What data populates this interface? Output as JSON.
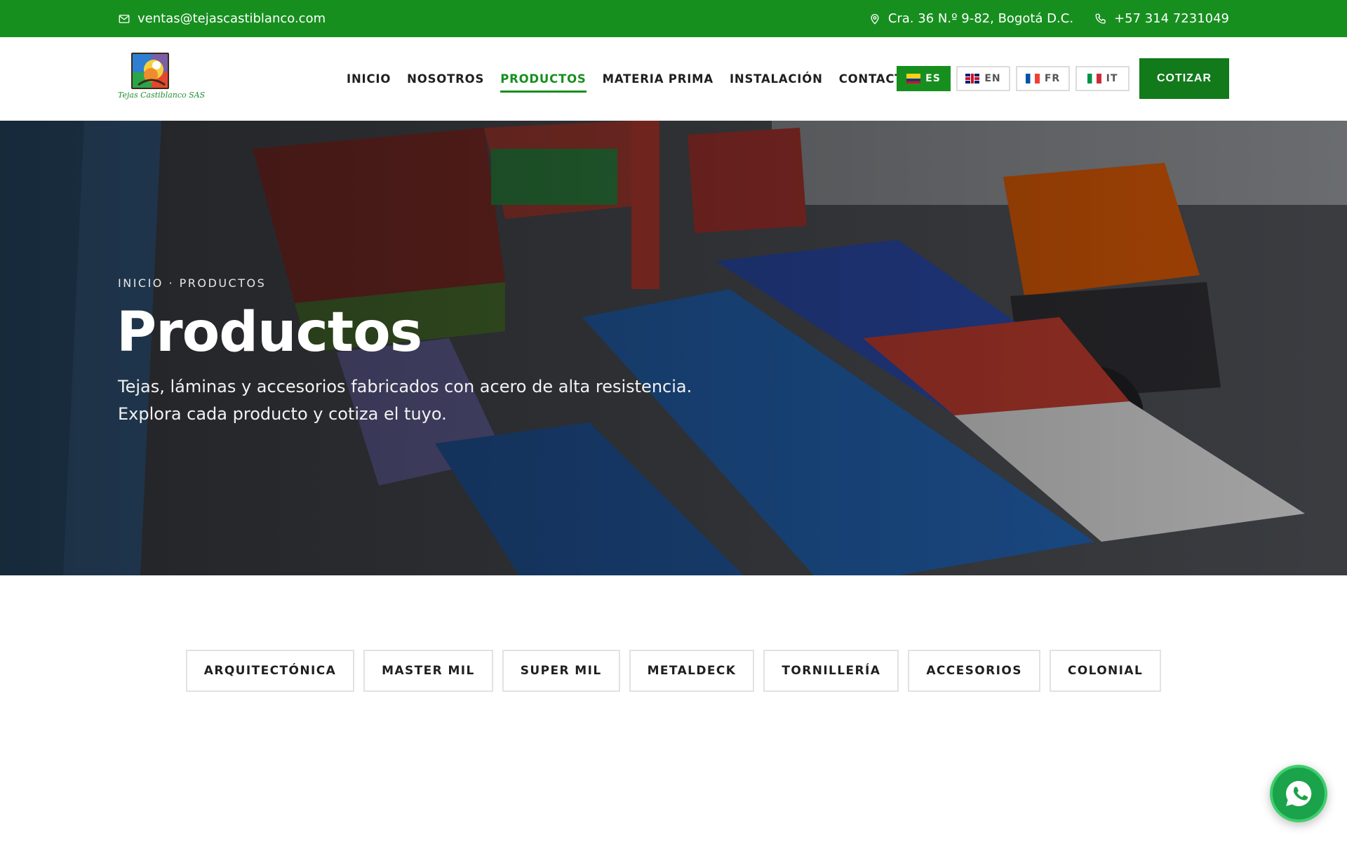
{
  "topbar": {
    "email": "ventas@tejascastiblanco.com",
    "address": "Cra. 36 N.º 9-82, Bogotá D.C.",
    "phone": "+57 314 7231049"
  },
  "logo": {
    "caption": "Tejas Castiblanco SAS"
  },
  "nav": {
    "items": [
      "INICIO",
      "NOSOTROS",
      "PRODUCTOS",
      "MATERIA PRIMA",
      "INSTALACIÓN",
      "CONTACTO"
    ],
    "active": "PRODUCTOS"
  },
  "languages": [
    {
      "code": "ES",
      "flag": "colombia-flag-icon",
      "active": true
    },
    {
      "code": "EN",
      "flag": "uk-flag-icon",
      "active": false
    },
    {
      "code": "FR",
      "flag": "france-flag-icon",
      "active": false
    },
    {
      "code": "IT",
      "flag": "italy-flag-icon",
      "active": false
    }
  ],
  "cta": {
    "label": "COTIZAR"
  },
  "hero": {
    "breadcrumb": "INICIO · PRODUCTOS",
    "title": "Productos",
    "subtitle_line1": "Tejas, láminas y accesorios fabricados con acero de alta resistencia.",
    "subtitle_line2": "Explora cada producto y cotiza el tuyo."
  },
  "product_tabs": [
    "ARQUITECTÓNICA",
    "MASTER MIL",
    "SUPER MIL",
    "METALDECK",
    "TORNILLERÍA",
    "ACCESORIOS",
    "COLONIAL"
  ],
  "colors": {
    "brand_green": "#178f1f",
    "cta_green": "#127a1b",
    "whatsapp_green": "#1aa34a"
  },
  "icons": {
    "email": "mail-icon",
    "address": "location-pin-icon",
    "phone": "phone-icon",
    "whatsapp": "whatsapp-icon"
  }
}
